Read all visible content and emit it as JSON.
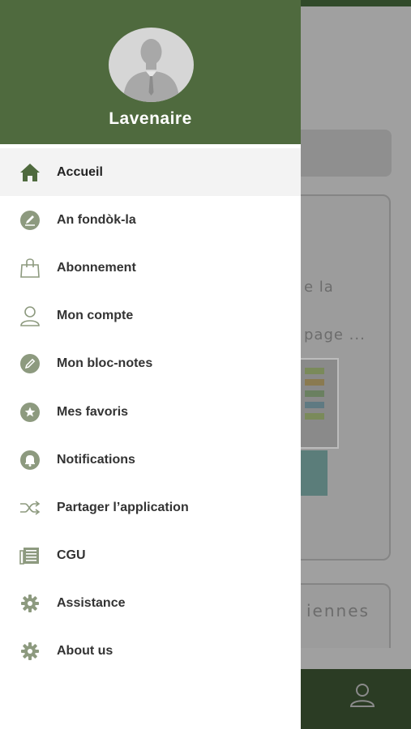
{
  "user": {
    "name": "Lavenaire"
  },
  "menu": {
    "items": [
      {
        "label": "Accueil",
        "icon": "home-icon",
        "active": true
      },
      {
        "label": "An fondòk-la",
        "icon": "pencil-icon"
      },
      {
        "label": "Abonnement",
        "icon": "shopping-bag-icon"
      },
      {
        "label": "Mon compte",
        "icon": "user-icon"
      },
      {
        "label": "Mon bloc-notes",
        "icon": "notepad-pencil-icon"
      },
      {
        "label": "Mes favoris",
        "icon": "star-icon"
      },
      {
        "label": "Notifications",
        "icon": "bell-icon"
      },
      {
        "label": "Partager l’application",
        "icon": "shuffle-icon"
      },
      {
        "label": "CGU",
        "icon": "newspaper-icon"
      },
      {
        "label": "Assistance",
        "icon": "gear-icon"
      },
      {
        "label": "About us",
        "icon": "gear-icon"
      }
    ]
  },
  "background": {
    "partial_text_1": "e la",
    "partial_text_2": "page ...",
    "partial_text_3": "iennes"
  },
  "colors": {
    "header_green": "#4f6a3e",
    "icon_green": "#4f6a3e",
    "icon_gray_green": "#7e8c70"
  }
}
